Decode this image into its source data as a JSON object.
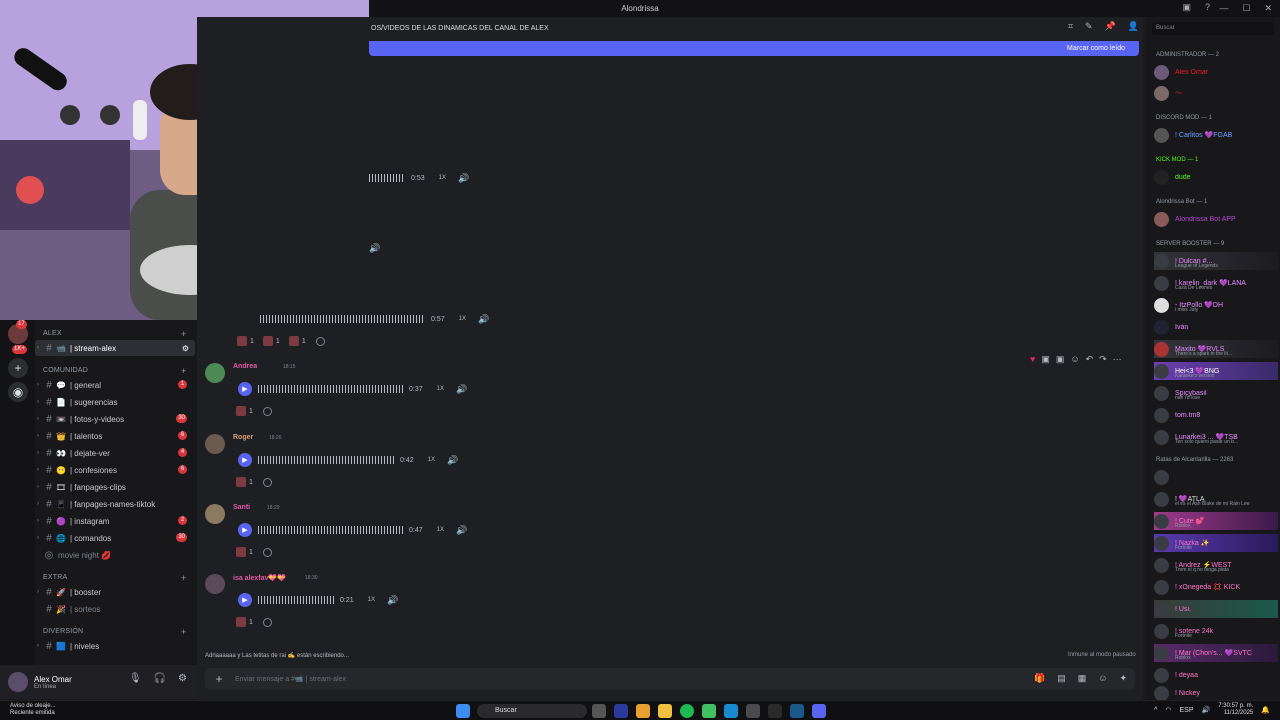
{
  "window": {
    "title": "Alondrissa",
    "controls": [
      "—",
      "☐",
      "✕"
    ]
  },
  "channel": {
    "header": "OS/VIDEOS DE LAS DINAMICAS DEL CANAL DE ALEX",
    "new_messages_label": "Marcar como leído",
    "composer_placeholder": "Enviar mensaje a #📹 | stream-alex",
    "typing": "Adriaaaaaa y Las tetitas de rai ✍ están escribiendo...",
    "slowmode": "Inmune al modo pausado"
  },
  "rail": {
    "badges": [
      "17",
      "1K+"
    ]
  },
  "sidebar": {
    "categories": {
      "alex": "ALEX",
      "comunidad": "COMUNIDAD",
      "extra": "EXTRA",
      "diversion": "DIVERSIÓN"
    },
    "channels": [
      {
        "label": "| stream-alex",
        "emoji": "📹",
        "badge": ""
      },
      {
        "label": "| general",
        "emoji": "💬",
        "badge": "1"
      },
      {
        "label": "| sugerencias",
        "emoji": "📄",
        "badge": ""
      },
      {
        "label": "| fotos-y-videos",
        "emoji": "📼",
        "badge": "30"
      },
      {
        "label": "| talentos",
        "emoji": "👑",
        "badge": "6"
      },
      {
        "label": "| dejate-ver",
        "emoji": "👀",
        "badge": "4"
      },
      {
        "label": "| confesiones",
        "emoji": "😶",
        "badge": "6"
      },
      {
        "label": "| fanpages-clips",
        "emoji": "🎞",
        "badge": ""
      },
      {
        "label": "| fanpages-names-tiktok",
        "emoji": "📱",
        "badge": ""
      },
      {
        "label": "| instagram",
        "emoji": "🟣",
        "badge": "2"
      },
      {
        "label": "| comandos",
        "emoji": "🌐",
        "badge": "30"
      },
      {
        "label": "movie night 💋",
        "emoji": "",
        "badge": ""
      },
      {
        "label": "| booster",
        "emoji": "🚀",
        "badge": ""
      },
      {
        "label": "| sorteos",
        "emoji": "🎉",
        "badge": ""
      },
      {
        "label": "| niveles",
        "emoji": "🟦",
        "badge": ""
      }
    ]
  },
  "user": {
    "name": "Alex Omar",
    "status": "En línea"
  },
  "messages": [
    {
      "author": "Andrea",
      "time": "18:15",
      "duration": "0:37",
      "speed": "1X",
      "react_count": "1",
      "color": "#e05ba4"
    },
    {
      "author": "Roger",
      "time": "18:26",
      "duration": "0:42",
      "speed": "1X",
      "react_count": "1",
      "color": "#d8a07a"
    },
    {
      "author": "Santi",
      "time": "18:29",
      "duration": "0:47",
      "speed": "1X",
      "react_count": "1",
      "color": "#e05ba4"
    },
    {
      "author": "isa alexfav💝💝",
      "time": "18:30",
      "duration": "0:21",
      "speed": "1X",
      "react_count": "1",
      "color": "#e05ba4"
    }
  ],
  "upper_players": [
    {
      "duration": "0:53",
      "speed": "1X"
    },
    {
      "duration": "0:57",
      "speed": "1X"
    }
  ],
  "members": {
    "search_placeholder": "Buscar",
    "groups": [
      {
        "title": "ADMINISTRADOR — 2",
        "items": [
          {
            "name": "Alex Omar",
            "color": "#ed1c24"
          },
          {
            "name": "～",
            "color": "#ed1c24"
          }
        ]
      },
      {
        "title": "DISCORD MOD — 1",
        "items": [
          {
            "name": "! Carlitos 💜FGAB",
            "color": "#68a0ff"
          }
        ]
      },
      {
        "title": "KICK MOD — 1",
        "items": [
          {
            "name": "dude",
            "color": "#53fc18"
          }
        ]
      },
      {
        "title": "Alondrissa Bot — 1",
        "items": [
          {
            "name": "Alondrissa Bot APP",
            "color": "#b148d2"
          }
        ]
      },
      {
        "title": "SERVER BOOSTER — 9",
        "items": [
          {
            "name": "! Dulcan #...",
            "sub": "League of Legends",
            "color": "#e88cff"
          },
          {
            "name": "! karelin_dark 💜LANA",
            "sub": "Casa De Leones",
            "color": "#e88cff"
          },
          {
            "name": "- ItzPollo 💜DH",
            "sub": "i miss July",
            "color": "#e88cff"
          },
          {
            "name": "Iván",
            "sub": "",
            "color": "#e88cff"
          },
          {
            "name": "Maxito 💜RVLS",
            "sub": "There's a spark in the lit...",
            "color": "#e88cff"
          },
          {
            "name": "Hei<3 💜BNG",
            "sub": "Karaoke's version",
            "color": "#e88cff"
          },
          {
            "name": "Spicybasil",
            "sub": "nah i'd lose",
            "color": "#e88cff"
          },
          {
            "name": "tom.tm8",
            "sub": "",
            "color": "#e88cff"
          },
          {
            "name": "Lunarkei3 ... 💜TSB",
            "sub": "Ten solo quiero pasar un b...",
            "color": "#e88cff"
          }
        ]
      },
      {
        "title": "Ratas de Alcantarilla — 2263",
        "items": [
          {
            "name": "",
            "sub": "",
            "color": "#dbdee1"
          },
          {
            "name": "! 💜ATLA",
            "sub": "el es el Ash Blake de mi Rain Lee",
            "color": "#dbdee1"
          },
          {
            "name": "! Cute 💕",
            "sub": "Roblox",
            "color": "#ff77c8"
          },
          {
            "name": "! Nazka ✨",
            "sub": "Fortnite",
            "color": "#ff77c8"
          },
          {
            "name": "! Andrez ⚡WEST",
            "sub": "Tmm el q no tenga plata",
            "color": "#ff77c8"
          },
          {
            "name": "! xOnegeda 💢 KICK",
            "sub": "",
            "color": "#ff77c8"
          },
          {
            "name": "! Usi.",
            "sub": "",
            "color": "#ff77c8"
          },
          {
            "name": "! sofene 24k",
            "sub": "Fortnite",
            "color": "#ff77c8"
          },
          {
            "name": "! Mar (Chon's... 💜SVTC",
            "sub": "Roblox",
            "color": "#ff77c8"
          },
          {
            "name": "! deyaa",
            "sub": "",
            "color": "#ff77c8"
          },
          {
            "name": "! Nickey",
            "sub": "",
            "color": "#ff77c8"
          }
        ]
      }
    ]
  },
  "taskbar": {
    "notice_title": "Aviso de oleaje...",
    "notice_sub": "Reciente emitida",
    "search": "Buscar",
    "lang": "ESP",
    "time": "7:30:57 p. m.",
    "date": "11/12/2025"
  }
}
